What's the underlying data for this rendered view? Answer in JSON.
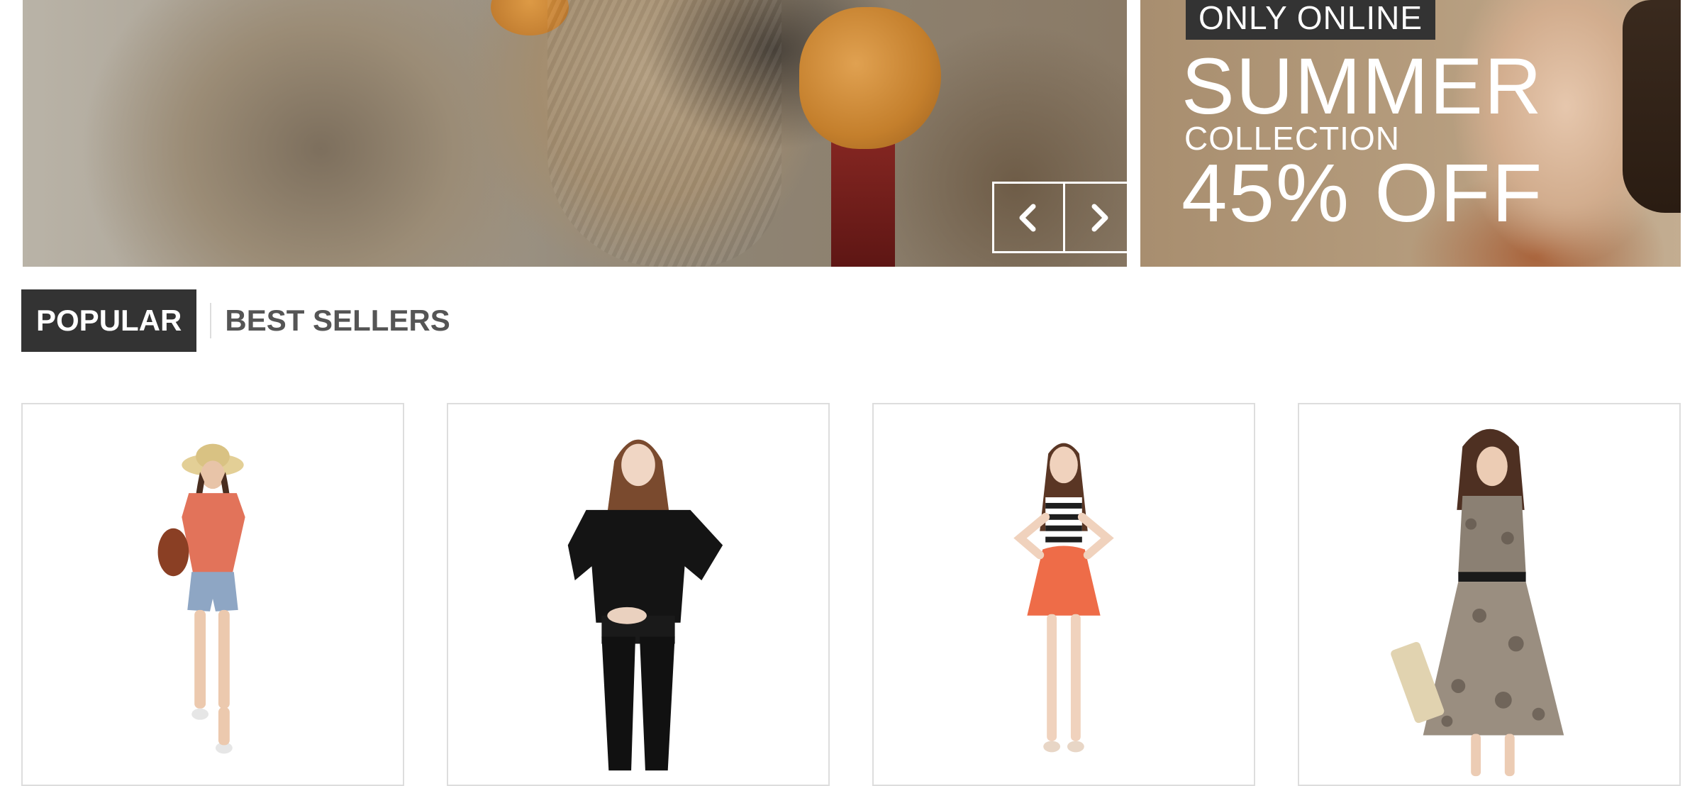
{
  "slider": {
    "prev_icon": "chevron-left-icon",
    "next_icon": "chevron-right-icon"
  },
  "promo": {
    "tag": "ONLY ONLINE",
    "headline": "SUMMER",
    "subhead": "COLLECTION",
    "discount": "45% OFF"
  },
  "tabs": [
    {
      "label": "POPULAR",
      "active": true
    },
    {
      "label": "BEST SELLERS",
      "active": false
    }
  ],
  "colors": {
    "tab_active_bg": "#333333",
    "tab_text": "#555555",
    "card_border": "#dddddd"
  }
}
